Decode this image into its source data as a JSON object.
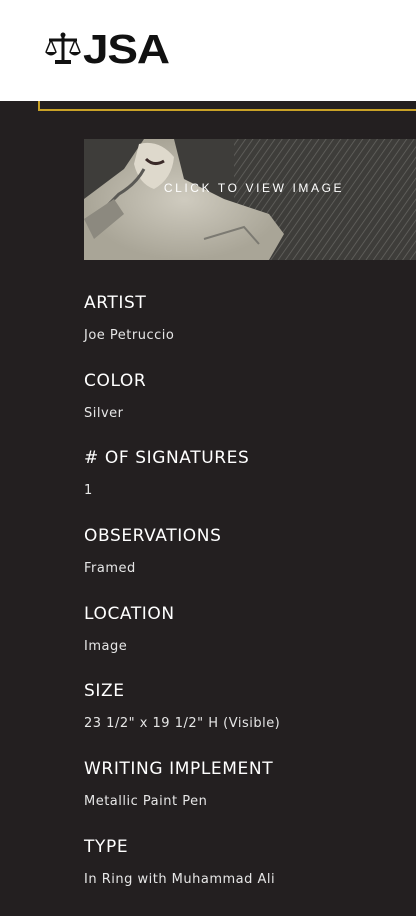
{
  "brand": {
    "name": "JSA"
  },
  "image_link": {
    "label": "CLICK TO VIEW IMAGE"
  },
  "details": [
    {
      "label": "ARTIST",
      "value": "Joe Petruccio"
    },
    {
      "label": "COLOR",
      "value": "Silver"
    },
    {
      "label": "# OF SIGNATURES",
      "value": "1"
    },
    {
      "label": "OBSERVATIONS",
      "value": "Framed"
    },
    {
      "label": "LOCATION",
      "value": "Image"
    },
    {
      "label": "SIZE",
      "value": "23 1/2\" x 19 1/2\" H (Visible)"
    },
    {
      "label": "WRITING IMPLEMENT",
      "value": "Metallic Paint Pen"
    },
    {
      "label": "TYPE",
      "value": "In Ring with Muhammad Ali"
    }
  ],
  "colors": {
    "background": "#231f20",
    "accent": "#c9a227",
    "header": "#ffffff"
  },
  "icons": {
    "logo": "scales-of-justice-icon"
  }
}
